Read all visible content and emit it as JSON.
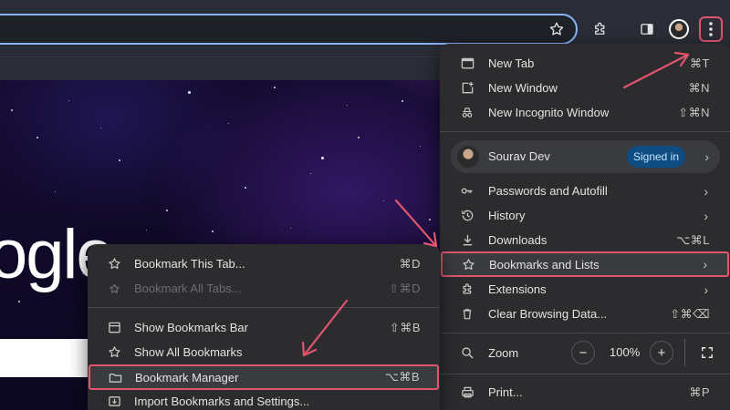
{
  "colors": {
    "accent_highlight": "#e0556d",
    "omnibox_border": "#8ab4f8",
    "menu_bg": "#2c2c2f",
    "signed_in_badge": "#0f4c81"
  },
  "page": {
    "logo_text": "ogle"
  },
  "main_menu": {
    "items": [
      {
        "label": "New Tab",
        "shortcut": "⌘T",
        "icon": "new-tab-icon"
      },
      {
        "label": "New Window",
        "shortcut": "⌘N",
        "icon": "new-window-icon"
      },
      {
        "label": "New Incognito Window",
        "shortcut": "⇧⌘N",
        "icon": "incognito-icon"
      }
    ],
    "profile": {
      "name": "Sourav Dev",
      "badge": "Signed in"
    },
    "items2": [
      {
        "label": "Passwords and Autofill",
        "icon": "key-icon"
      },
      {
        "label": "History",
        "icon": "history-icon"
      },
      {
        "label": "Downloads",
        "shortcut": "⌥⌘L",
        "icon": "download-icon"
      },
      {
        "label": "Bookmarks and Lists",
        "icon": "star-icon"
      },
      {
        "label": "Extensions",
        "icon": "puzzle-icon"
      },
      {
        "label": "Clear Browsing Data...",
        "shortcut": "⇧⌘⌫",
        "icon": "trash-icon"
      }
    ],
    "zoom": {
      "label": "Zoom",
      "minus": "−",
      "value": "100%",
      "plus": "+"
    },
    "print": {
      "label": "Print...",
      "shortcut": "⌘P"
    }
  },
  "bookmarks_submenu": {
    "items": [
      {
        "label": "Bookmark This Tab...",
        "shortcut": "⌘D"
      },
      {
        "label": "Bookmark All Tabs...",
        "shortcut": "⇧⌘D",
        "disabled": true
      },
      {
        "label": "Show Bookmarks Bar",
        "shortcut": "⇧⌘B"
      },
      {
        "label": "Show All Bookmarks",
        "shortcut": ""
      },
      {
        "label": "Bookmark Manager",
        "shortcut": "⌥⌘B"
      },
      {
        "label": "Import Bookmarks and Settings...",
        "shortcut": ""
      }
    ]
  }
}
